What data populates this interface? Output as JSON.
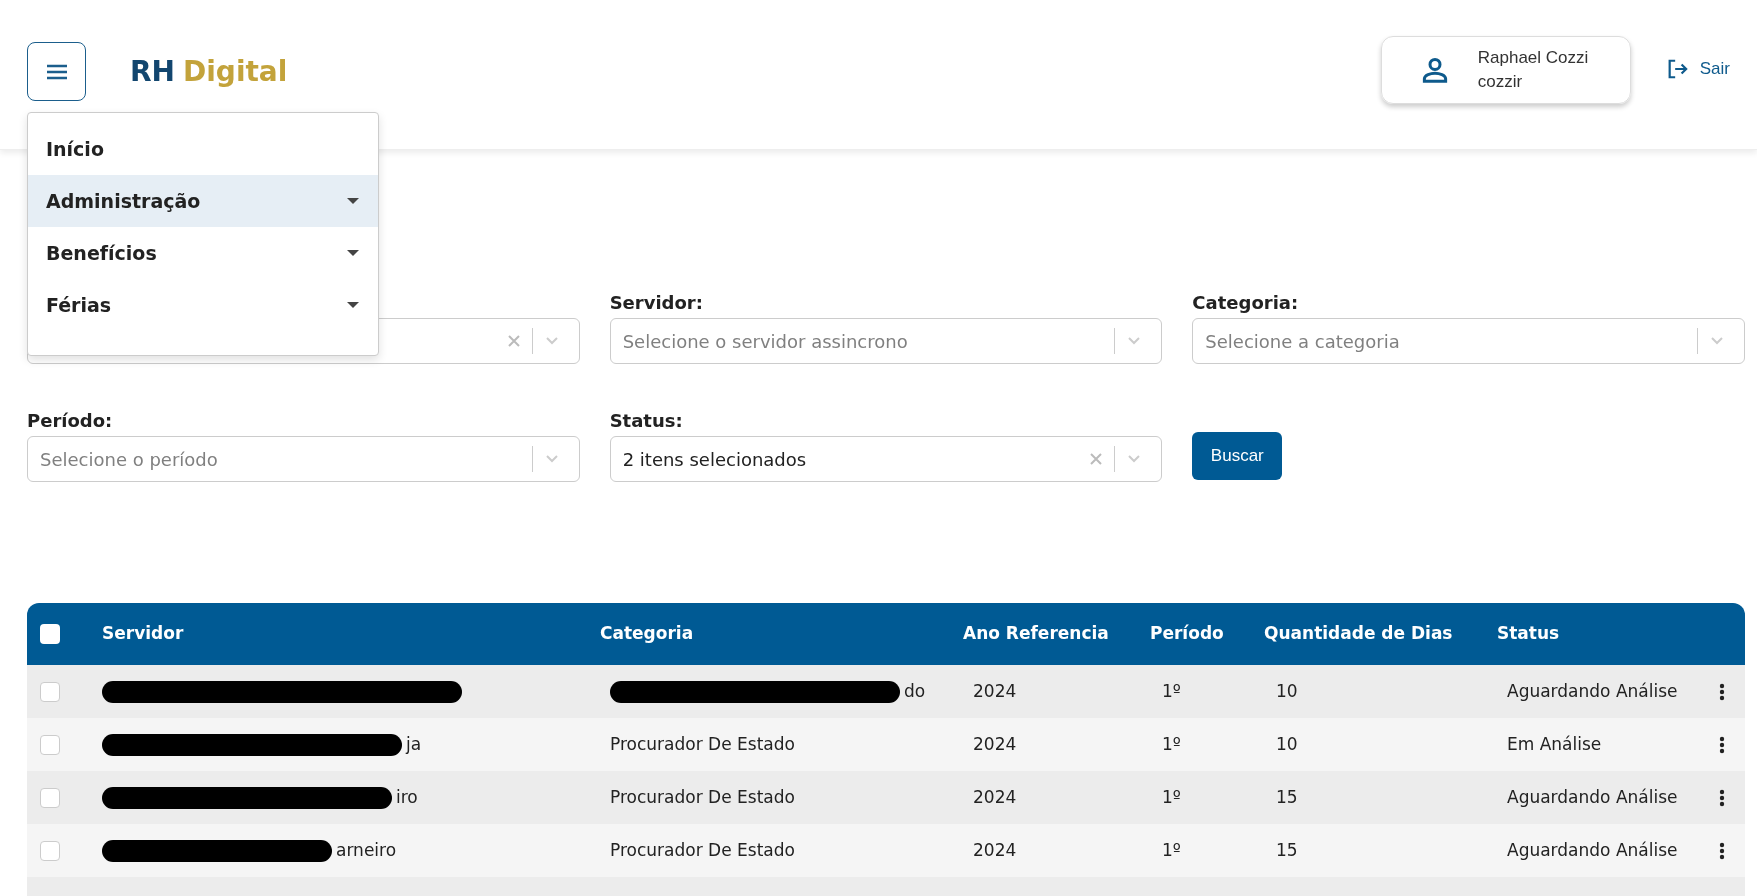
{
  "header": {
    "logo": {
      "part1": "RH",
      "part2": "Digital"
    },
    "user": {
      "name": "Raphael Cozzi",
      "login": "cozzir"
    },
    "logout": "Sair"
  },
  "menu": {
    "items": [
      {
        "label": "Início",
        "has_submenu": false,
        "selected": false
      },
      {
        "label": "Administração",
        "has_submenu": true,
        "selected": true
      },
      {
        "label": "Benefícios",
        "has_submenu": true,
        "selected": false
      },
      {
        "label": "Férias",
        "has_submenu": true,
        "selected": false
      }
    ]
  },
  "filters": [
    {
      "kind": "select",
      "clearable": true
    },
    {
      "kind": "select",
      "label": "Servidor:",
      "placeholder": "Selecione o servidor assincrono",
      "clearable": false
    },
    {
      "kind": "select",
      "label": "Categoria:",
      "placeholder": "Selecione a categoria",
      "clearable": false
    },
    {
      "kind": "select",
      "label": "Período:",
      "placeholder": "Selecione o período",
      "clearable": false
    },
    {
      "kind": "select",
      "label": "Status:",
      "value": "2 itens selecionados",
      "clearable": true
    },
    {
      "kind": "button",
      "label": "Buscar"
    }
  ],
  "table": {
    "all_checked": false,
    "columns": [
      "Servidor",
      "Categoria",
      "Ano Referencia",
      "Período",
      "Quantidade de Dias",
      "Status"
    ],
    "rows": [
      {
        "checked": false,
        "servidor": {
          "redacted": true
        },
        "categoria": {
          "redacted": true,
          "text": "do"
        },
        "ano": "2024",
        "periodo": "1º",
        "dias": "10",
        "status": "Aguardando Análise"
      },
      {
        "checked": false,
        "servidor": {
          "redacted": true,
          "text": "ja"
        },
        "categoria": {
          "redacted": false,
          "text": "Procurador De Estado"
        },
        "ano": "2024",
        "periodo": "1º",
        "dias": "10",
        "status": "Em Análise"
      },
      {
        "checked": false,
        "servidor": {
          "redacted": true,
          "text": "iro"
        },
        "categoria": {
          "redacted": false,
          "text": "Procurador De Estado"
        },
        "ano": "2024",
        "periodo": "1º",
        "dias": "15",
        "status": "Aguardando Análise"
      },
      {
        "checked": false,
        "servidor": {
          "redacted": true,
          "text": "arneiro"
        },
        "categoria": {
          "redacted": false,
          "text": "Procurador De Estado"
        },
        "ano": "2024",
        "periodo": "1º",
        "dias": "15",
        "status": "Aguardando Análise"
      }
    ]
  }
}
